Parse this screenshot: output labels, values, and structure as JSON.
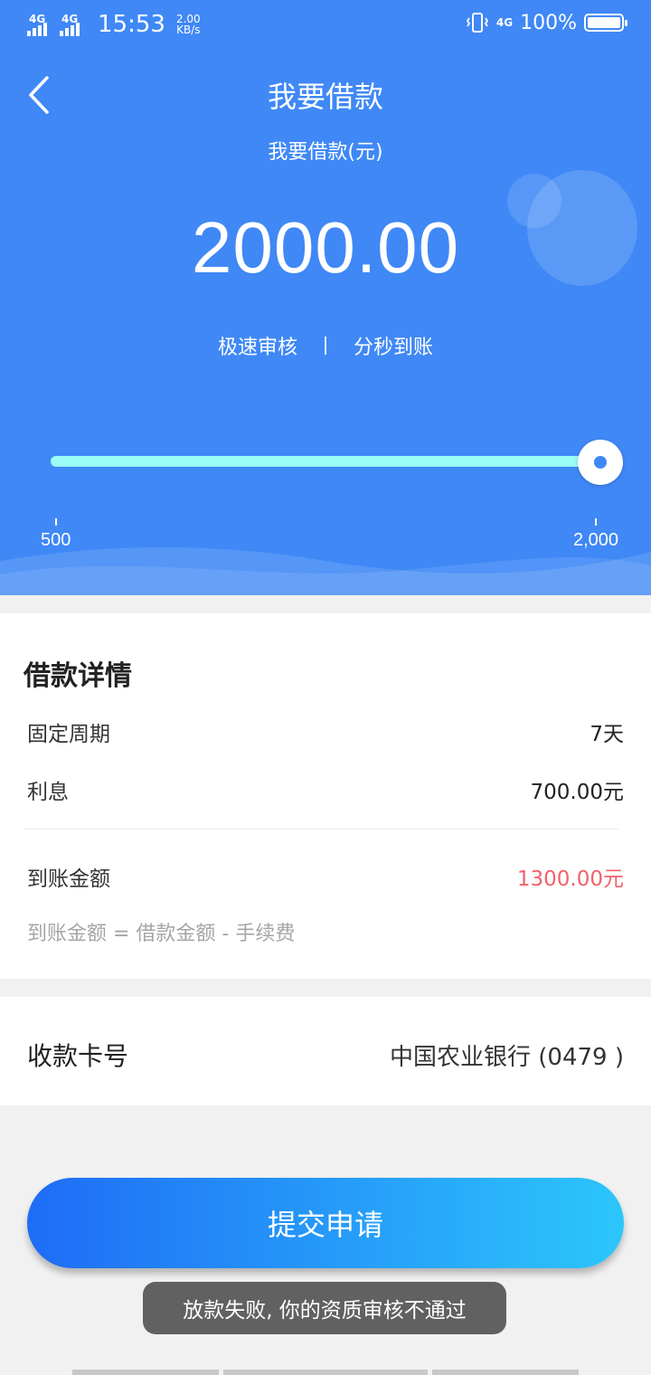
{
  "status_bar": {
    "network1": "4G",
    "network2": "4G",
    "time": "15:53",
    "speed_value": "2.00",
    "speed_unit": "KB/s",
    "network3": "4G",
    "battery": "100%",
    "icons": [
      "signal-icon",
      "vibrate-icon",
      "battery-icon"
    ]
  },
  "header": {
    "back_icon": "chevron-left-icon",
    "title": "我要借款",
    "subtitle": "我要借款(元)",
    "amount": "2000.00",
    "features": [
      "极速审核",
      "分秒到账"
    ]
  },
  "slider": {
    "min_label": "500",
    "max_label": "2,000",
    "min": 500,
    "max": 2000,
    "value": 2000
  },
  "details": {
    "title": "借款详情",
    "rows": [
      {
        "label": "固定周期",
        "value": "7天"
      },
      {
        "label": "利息",
        "value": "700.00元"
      }
    ],
    "arrival": {
      "label": "到账金额",
      "value": "1300.00元"
    },
    "formula": "到账金额 = 借款金额 - 手续费"
  },
  "card": {
    "label": "收款卡号",
    "bank": "中国农业银行 (0479 )"
  },
  "submit_label": "提交申请",
  "toast": "放款失败, 你的资质审核不通过",
  "colors": {
    "primary": "#3f88f6",
    "track": "#9bfbf5",
    "accent_red": "#f0616c",
    "button_gradient": [
      "#1f6cf6",
      "#2cc6fb"
    ]
  }
}
